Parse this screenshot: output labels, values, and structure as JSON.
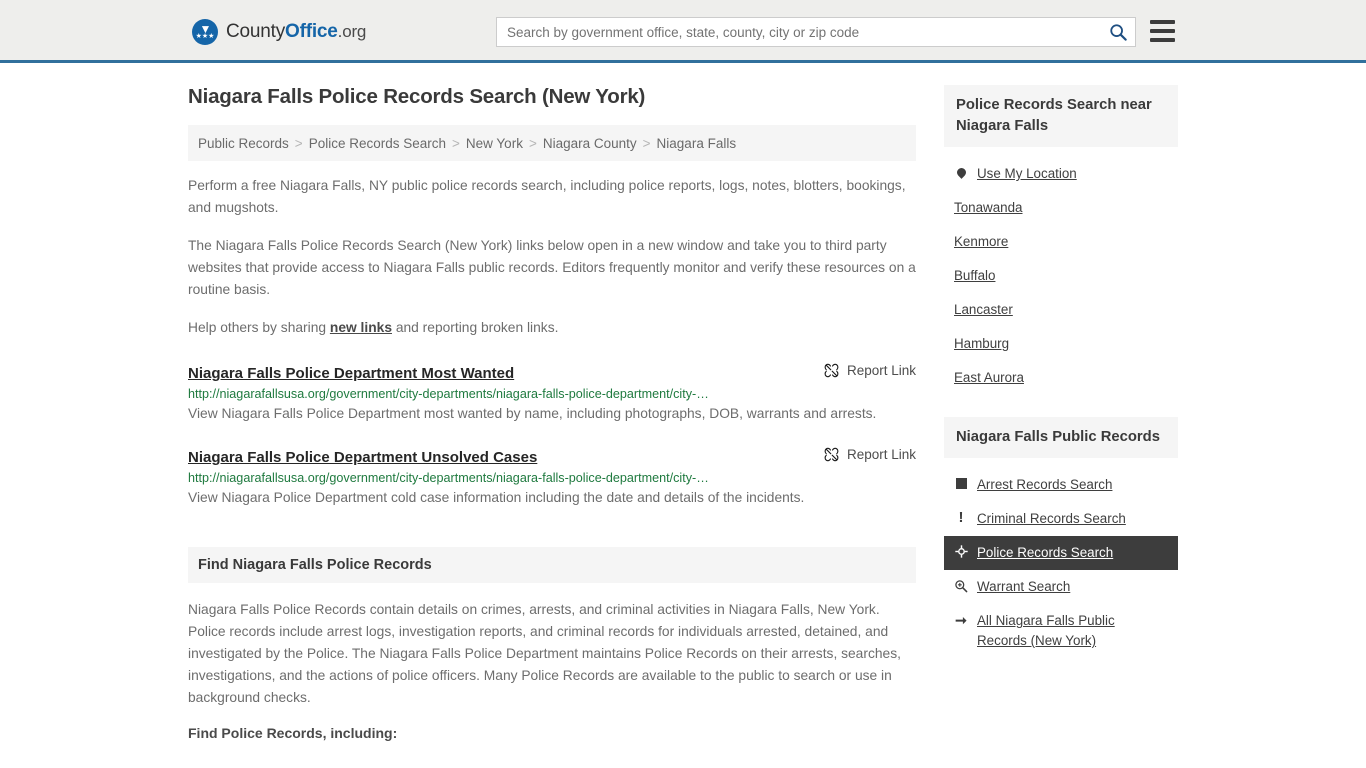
{
  "header": {
    "brand": {
      "part1": "County",
      "part2": "Office",
      "part3": ".org"
    },
    "search": {
      "placeholder": "Search by government office, state, county, city or zip code",
      "value": ""
    }
  },
  "page": {
    "title": "Niagara Falls Police Records Search (New York)"
  },
  "breadcrumb": {
    "items": [
      {
        "label": "Public Records"
      },
      {
        "label": "Police Records Search"
      },
      {
        "label": "New York"
      },
      {
        "label": "Niagara County"
      },
      {
        "label": "Niagara Falls"
      }
    ],
    "separator": ">"
  },
  "intro": {
    "p1": "Perform a free Niagara Falls, NY public police records search, including police reports, logs, notes, blotters, bookings, and mugshots.",
    "p2": "The Niagara Falls Police Records Search (New York) links below open in a new window and take you to third party websites that provide access to Niagara Falls public records. Editors frequently monitor and verify these resources on a routine basis.",
    "p3_before": "Help others by sharing ",
    "p3_link": "new links",
    "p3_after": " and reporting broken links."
  },
  "results": [
    {
      "title": "Niagara Falls Police Department Most Wanted",
      "url": "http://niagarafallsusa.org/government/city-departments/niagara-falls-police-department/city-…",
      "description": "View Niagara Falls Police Department most wanted by name, including photographs, DOB, warrants and arrests.",
      "report_label": "Report Link"
    },
    {
      "title": "Niagara Falls Police Department Unsolved Cases",
      "url": "http://niagarafallsusa.org/government/city-departments/niagara-falls-police-department/city-…",
      "description": "View Niagara Police Department cold case information including the date and details of the incidents.",
      "report_label": "Report Link"
    }
  ],
  "find_section": {
    "heading": "Find Niagara Falls Police Records",
    "body": "Niagara Falls Police Records contain details on crimes, arrests, and criminal activities in Niagara Falls, New York. Police records include arrest logs, investigation reports, and criminal records for individuals arrested, detained, and investigated by the Police. The Niagara Falls Police Department maintains Police Records on their arrests, searches, investigations, and the actions of police officers. Many Police Records are available to the public to search or use in background checks.",
    "subheading": "Find Police Records, including:"
  },
  "sidebar": {
    "near_panel": {
      "heading": "Police Records Search near Niagara Falls",
      "items": [
        {
          "label": "Use My Location",
          "icon": "map-pin-icon"
        },
        {
          "label": "Tonawanda",
          "icon": ""
        },
        {
          "label": "Kenmore",
          "icon": ""
        },
        {
          "label": "Buffalo",
          "icon": ""
        },
        {
          "label": "Lancaster",
          "icon": ""
        },
        {
          "label": "Hamburg",
          "icon": ""
        },
        {
          "label": "East Aurora",
          "icon": ""
        }
      ]
    },
    "public_records_panel": {
      "heading": "Niagara Falls Public Records",
      "items": [
        {
          "label": "Arrest Records Search",
          "icon": "square-icon",
          "active": false
        },
        {
          "label": "Criminal Records Search",
          "icon": "exclamation-icon",
          "active": false
        },
        {
          "label": "Police Records Search",
          "icon": "target-icon",
          "active": true
        },
        {
          "label": "Warrant Search",
          "icon": "zoom-in-icon",
          "active": false
        },
        {
          "label": "All Niagara Falls Public Records (New York)",
          "icon": "arrow-right-icon",
          "active": false
        }
      ]
    }
  },
  "colors": {
    "brand_blue": "#1565a8",
    "header_bg": "#eeeeec",
    "header_border": "#31709c",
    "panel_bg": "#f5f5f5",
    "url_green": "#1f7a3f",
    "active_row": "#3d3d3d"
  }
}
